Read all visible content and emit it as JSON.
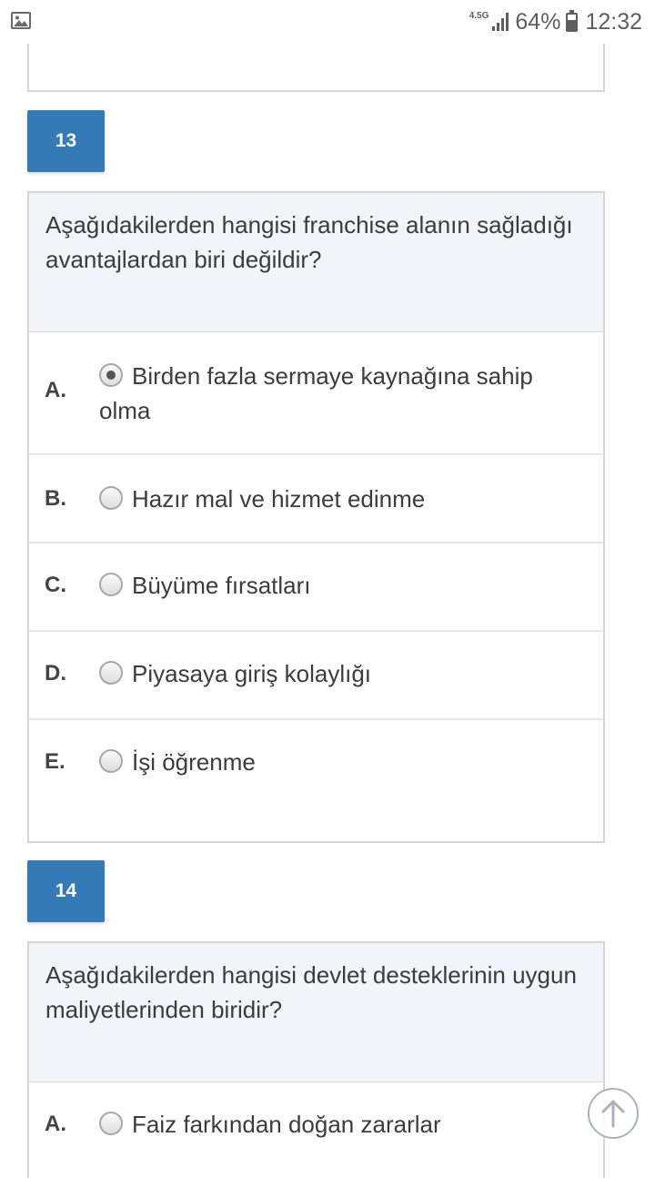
{
  "status_bar": {
    "network": "4.5G",
    "battery_percent": "64%",
    "time": "12:32"
  },
  "questions": [
    {
      "number": "13",
      "text": "Aşağıdakilerden hangisi franchise alanın sağladığı avantajlardan biri değildir?",
      "options": [
        {
          "letter": "A.",
          "text": "Birden fazla sermaye kaynağına sahip olma",
          "selected": true
        },
        {
          "letter": "B.",
          "text": "Hazır mal ve hizmet edinme",
          "selected": false
        },
        {
          "letter": "C.",
          "text": "Büyüme fırsatları",
          "selected": false
        },
        {
          "letter": "D.",
          "text": "Piyasaya giriş kolaylığı",
          "selected": false
        },
        {
          "letter": "E.",
          "text": "İşi öğrenme",
          "selected": false
        }
      ]
    },
    {
      "number": "14",
      "text": "Aşağıdakilerden hangisi devlet desteklerinin uygun maliyetlerinden biridir?",
      "options": [
        {
          "letter": "A.",
          "text": "Faiz farkından doğan zararlar",
          "selected": false
        }
      ]
    }
  ],
  "icons": {
    "status_left": "gallery-icon",
    "scroll_button": "arrow-up-icon"
  }
}
